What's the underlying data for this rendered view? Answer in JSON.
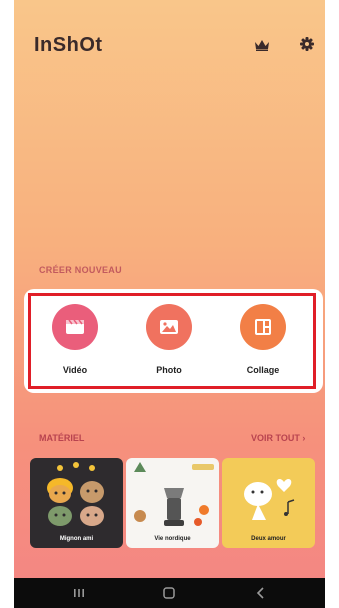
{
  "app": {
    "title": "InShOt"
  },
  "create": {
    "section_label": "CRÉER NOUVEAU",
    "items": [
      {
        "label": "Vidéo",
        "icon": "clapperboard-icon"
      },
      {
        "label": "Photo",
        "icon": "image-icon"
      },
      {
        "label": "Collage",
        "icon": "collage-layout-icon"
      }
    ]
  },
  "materials": {
    "section_label": "MATÉRIEL",
    "see_all_label": "VOIR TOUT",
    "cards": [
      {
        "caption": "Mignon ami"
      },
      {
        "caption": "Vie nordique"
      },
      {
        "caption": "Deux amour"
      }
    ]
  },
  "colors": {
    "bg_top": "#f9c68a",
    "bg_bottom": "#f48584",
    "video": "#ea5e7b",
    "photo": "#f0725f",
    "collage": "#f27f46",
    "highlight": "#e01e28"
  }
}
